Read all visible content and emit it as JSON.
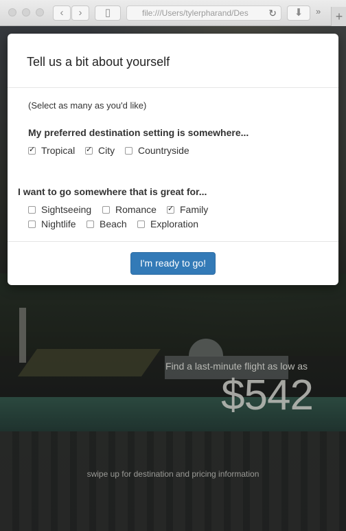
{
  "browser": {
    "url": "file:///Users/tylerpharand/Des",
    "more_label": "»",
    "new_tab_label": "+"
  },
  "modal": {
    "title": "Tell us a bit about yourself",
    "hint": "(Select as many as you'd like)",
    "q1": {
      "label": "My preferred destination setting is somewhere...",
      "options": [
        {
          "label": "Tropical",
          "checked": true
        },
        {
          "label": "City",
          "checked": true
        },
        {
          "label": "Countryside",
          "checked": false
        }
      ]
    },
    "q2": {
      "label": "I want to go somewhere that is great for...",
      "options": [
        {
          "label": "Sightseeing",
          "checked": false
        },
        {
          "label": "Romance",
          "checked": false
        },
        {
          "label": "Family",
          "checked": true
        },
        {
          "label": "Nightlife",
          "checked": false
        },
        {
          "label": "Beach",
          "checked": false
        },
        {
          "label": "Exploration",
          "checked": false
        }
      ]
    },
    "submit_label": "I'm ready to go!"
  },
  "promo": {
    "label": "Find a last-minute flight as low as",
    "price": "$542",
    "swipe_hint": "swipe up for destination and pricing information"
  },
  "colors": {
    "primary_button": "#337ab7"
  }
}
